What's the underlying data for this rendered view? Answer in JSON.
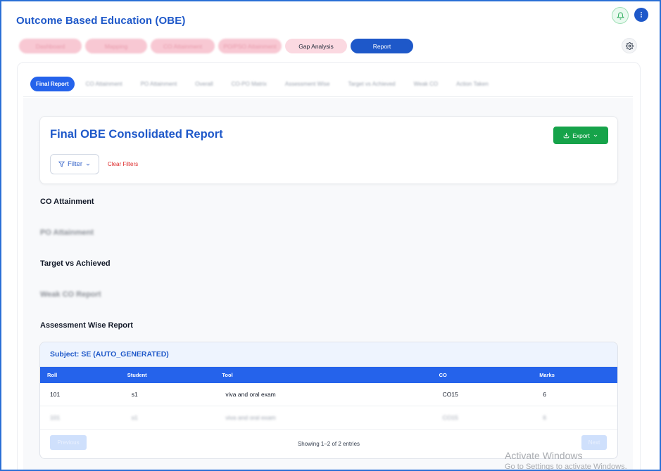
{
  "app": {
    "title": "Outcome Based Education (OBE)"
  },
  "header_icons": {
    "notifications": "bell-icon",
    "menu": "more-vertical-icon",
    "settings": "gear-icon"
  },
  "main_tabs": [
    {
      "label": "Dashboard",
      "state": "blurred"
    },
    {
      "label": "Mapping",
      "state": "blurred"
    },
    {
      "label": "CO Attainment",
      "state": "blurred"
    },
    {
      "label": "PO/PSO Attainment",
      "state": "blurred"
    },
    {
      "label": "Gap Analysis",
      "state": "normal"
    },
    {
      "label": "Report",
      "state": "active"
    }
  ],
  "sub_tabs": [
    {
      "label": "Final Report",
      "active": true
    },
    {
      "label": "CO Attainment"
    },
    {
      "label": "PO Attainment"
    },
    {
      "label": "Overall"
    },
    {
      "label": "CO-PO Matrix"
    },
    {
      "label": "Assessment Wise"
    },
    {
      "label": "Target vs Achieved"
    },
    {
      "label": "Weak CO"
    },
    {
      "label": "Action Taken"
    }
  ],
  "report": {
    "title": "Final OBE Consolidated Report",
    "export_label": "Export",
    "filter_label": "Filter",
    "clear_filters_label": "Clear Filters"
  },
  "sections": {
    "co_attainment": "CO Attainment",
    "po_attainment": "PO Attainment",
    "target_vs_achieved": "Target vs Achieved",
    "weak_co": "Weak CO Report",
    "assessment_wise": "Assessment Wise Report"
  },
  "subject": {
    "title": "Subject: SE (AUTO_GENERATED)",
    "columns": [
      "Roll",
      "Student",
      "Tool",
      "CO",
      "Marks"
    ],
    "rows": [
      {
        "roll": "101",
        "student": "s1",
        "tool": "viva and oral exam",
        "co": "CO15",
        "marks": "6"
      },
      {
        "roll": "101",
        "student": "s1",
        "tool": "viva and oral exam",
        "co": "CO15",
        "marks": "6"
      }
    ],
    "pagination": {
      "previous": "Previous",
      "showing": "Showing 1–2 of 2 entries",
      "next": "Next"
    }
  },
  "watermark": {
    "line1": "Activate Windows",
    "line2": "Go to Settings to activate Windows."
  },
  "colors": {
    "primary": "#1e58c9",
    "export": "#16a34a",
    "danger": "#dc2626",
    "table_header": "#2563eb"
  }
}
